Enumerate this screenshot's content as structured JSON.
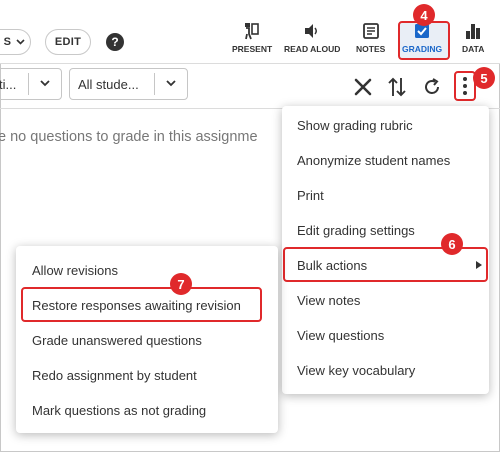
{
  "toolbar": {
    "left_pill_label": "S",
    "edit_label": "EDIT",
    "help_label": "?",
    "tools": [
      {
        "label": "PRESENT",
        "icon": "present-icon"
      },
      {
        "label": "READ ALOUD",
        "icon": "speaker-icon"
      },
      {
        "label": "NOTES",
        "icon": "notes-icon"
      },
      {
        "label": "GRADING",
        "icon": "grading-icon",
        "active": true
      },
      {
        "label": "DATA",
        "icon": "bar-chart-icon"
      }
    ]
  },
  "filters": {
    "first_select_value": "ti...",
    "student_select_value": "All stude..."
  },
  "actions": [
    "close-icon",
    "sort-icon",
    "refresh-icon",
    "more-vertical-icon"
  ],
  "message": "e no questions to grade in this assignme",
  "main_menu": {
    "items": [
      "Show grading rubric",
      "Anonymize student names",
      "Print",
      "Edit grading settings",
      "Bulk actions",
      "View notes",
      "View questions",
      "View key vocabulary"
    ]
  },
  "bulk_menu": {
    "items": [
      "Allow revisions",
      "Restore responses awaiting revision",
      "Grade unanswered questions",
      "Redo assignment by student",
      "Mark questions as not grading"
    ]
  },
  "callouts": {
    "grading": "4",
    "kebab": "5",
    "bulk_actions": "6",
    "restore": "7"
  },
  "colors": {
    "callout_red": "#e0292b",
    "active_blue": "#1b67c9"
  }
}
